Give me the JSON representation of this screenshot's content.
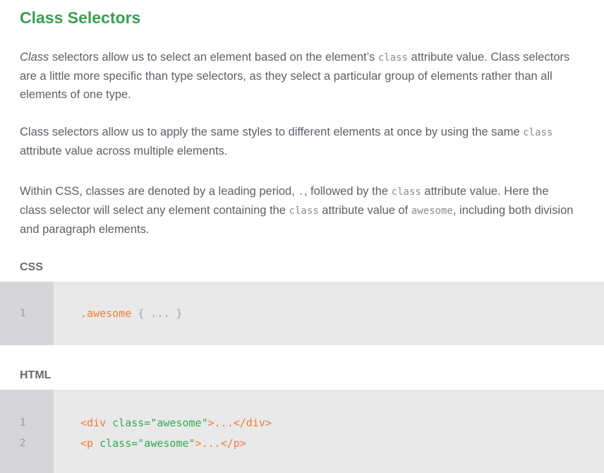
{
  "heading": "Class Selectors",
  "para1": {
    "em": "Class",
    "t1": " selectors allow us to select an element based on the element’s ",
    "code1": "class",
    "t2": " attribute value. Class selectors are a little more specific than type selectors, as they select a particular group of elements rather than all elements of one type."
  },
  "para2": {
    "t1": "Class selectors allow us to apply the same styles to different elements at once by using the same ",
    "code1": "class",
    "t2": " attribute value across multiple elements."
  },
  "para3": {
    "t1": "Within CSS, classes are denoted by a leading period, ",
    "code1": ".",
    "t2": ", followed by the ",
    "code2": "class",
    "t3": " attribute value. Here the class selector will select any element containing the ",
    "code3": "class",
    "t4": " attribute value of ",
    "code4": "awesome",
    "t5": ", including both division and paragraph elements."
  },
  "css_block": {
    "label": "CSS",
    "lines": [
      {
        "num": "1",
        "selector": ".awesome",
        "rest": " { ... }"
      }
    ]
  },
  "html_block": {
    "label": "HTML",
    "lines": [
      {
        "num": "1",
        "open": "<div ",
        "attr": "class=\"awesome\"",
        "close": ">...</div>"
      },
      {
        "num": "2",
        "open": "<p ",
        "attr": "class=\"awesome\"",
        "close": ">...</p>"
      }
    ]
  },
  "colors": {
    "heading": "#3aa04f",
    "tag": "#f07c2f",
    "attribute": "#34a853",
    "code_bg": "#e9e9ea",
    "gutter_bg": "#d6d6d8"
  }
}
